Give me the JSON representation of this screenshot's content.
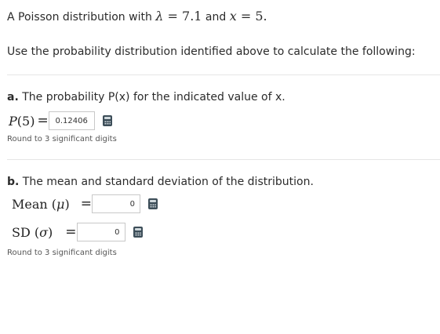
{
  "intro": {
    "prefix": "A Poisson distribution with",
    "lambda_symbol": "λ",
    "lambda_eq": "= 7.1",
    "and_text": "and",
    "x_symbol": "x",
    "x_eq": "= 5."
  },
  "instruction": "Use the probability distribution identified above to calculate the following:",
  "part_a": {
    "letter": "a.",
    "text": "The probability P(x) for the indicated value of x.",
    "label_func": "P",
    "label_arg": "(5)",
    "equals": "=",
    "answer_value": "0.12406",
    "hint": "Round to 3 significant digits"
  },
  "part_b": {
    "letter": "b.",
    "text": "The mean and standard deviation of the distribution.",
    "mean_label": "Mean",
    "mean_symbol": "μ",
    "mean_equals": "=",
    "mean_value": "0",
    "sd_label": "SD",
    "sd_symbol": "σ",
    "sd_equals": "=",
    "sd_value": "0",
    "hint": "Round to 3 significant digits"
  },
  "icons": {
    "calculator": "calculator-icon"
  }
}
